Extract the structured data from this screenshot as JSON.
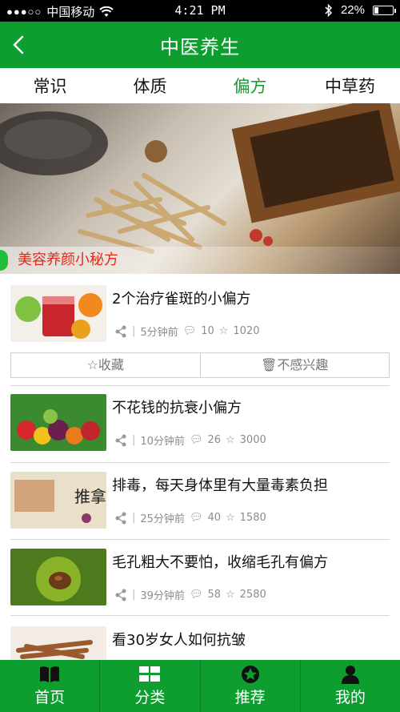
{
  "status": {
    "carrier": "中国移动",
    "time": "4:21 PM",
    "battery": "22%",
    "battery_level": 0.22
  },
  "header": {
    "title": "中医养生"
  },
  "tabs": [
    {
      "label": "常识"
    },
    {
      "label": "体质"
    },
    {
      "label": "偏方"
    },
    {
      "label": "中草药"
    }
  ],
  "banner": {
    "caption": "美容养颜小秘方"
  },
  "articles": [
    {
      "title": "2个治疗雀斑的小偏方",
      "time": "5分钟前",
      "comments": "10",
      "stars": "1020"
    },
    {
      "title": "不花钱的抗衰小偏方",
      "time": "10分钟前",
      "comments": "26",
      "stars": "3000"
    },
    {
      "title": "排毒，每天身体里有大量毒素负担",
      "time": "25分钟前",
      "comments": "40",
      "stars": "1580"
    },
    {
      "title": "毛孔粗大不要怕，收缩毛孔有偏方",
      "time": "39分钟前",
      "comments": "58",
      "stars": "2580"
    },
    {
      "title": "看30岁女人如何抗皱"
    }
  ],
  "actions": {
    "collect": "收藏",
    "not_interested": "不感兴趣"
  },
  "nav": [
    {
      "label": "首页",
      "icon": "book-icon"
    },
    {
      "label": "分类",
      "icon": "grid-icon"
    },
    {
      "label": "推荐",
      "icon": "star-badge-icon"
    },
    {
      "label": "我的",
      "icon": "user-icon"
    }
  ],
  "colors": {
    "primary": "#0e9e2f",
    "active_tab": "#119a2f",
    "banner_caption": "#e02a1c"
  }
}
